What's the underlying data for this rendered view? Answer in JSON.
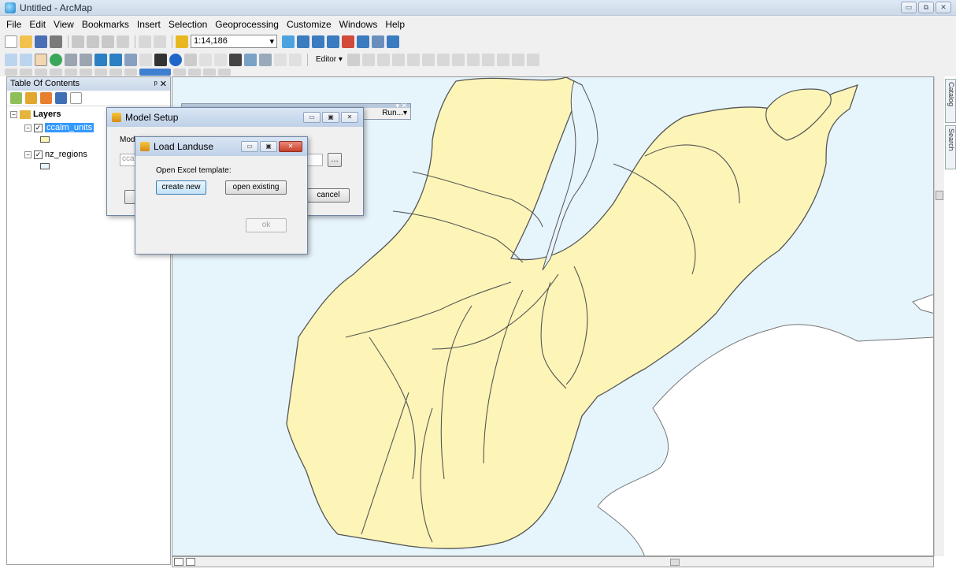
{
  "window": {
    "title": "Untitled - ArcMap",
    "min_glyph": "▭",
    "max_glyph": "⧉",
    "close_glyph": "✕"
  },
  "menu": [
    "File",
    "Edit",
    "View",
    "Bookmarks",
    "Insert",
    "Selection",
    "Geoprocessing",
    "Customize",
    "Windows",
    "Help"
  ],
  "toolbar": {
    "scale": "1:14,186",
    "scale_arrow": "▾",
    "editor_label": "Editor ▾"
  },
  "toc": {
    "title": "Table Of Contents",
    "pin_close": "ᵖ ✕",
    "root": "Layers",
    "layers": [
      {
        "name": "ccalm_units",
        "checked": "✓",
        "selected": true,
        "symbol_color": "#fdf5b7"
      },
      {
        "name": "nz_regions",
        "checked": "✓",
        "selected": false,
        "symbol_color": "#e6f4fb"
      }
    ]
  },
  "map": {
    "sea_color": "#e6f4fb",
    "land_color": "#fdf5b7",
    "outline_color": "#555555",
    "white_land": "#ffffff"
  },
  "floating_toolbar": {
    "run_label": "Run...▾",
    "close_glyph": "▾ ✕"
  },
  "side_tabs": [
    "Catalog",
    "Search"
  ],
  "model_setup": {
    "title": "Model Setup",
    "label_partial": "Mode",
    "textbox_partial": "ccal",
    "browse_glyph": "…",
    "cancel_label": "cancel",
    "min_glyph": "▭",
    "max_glyph": "▣",
    "close_glyph": "✕"
  },
  "load_landuse": {
    "title": "Load Landuse",
    "prompt": "Open Excel template:",
    "create_new_label": "create new",
    "open_existing_label": "open existing",
    "ok_label": "ok",
    "min_glyph": "▭",
    "max_glyph": "▣",
    "close_glyph": "✕"
  }
}
